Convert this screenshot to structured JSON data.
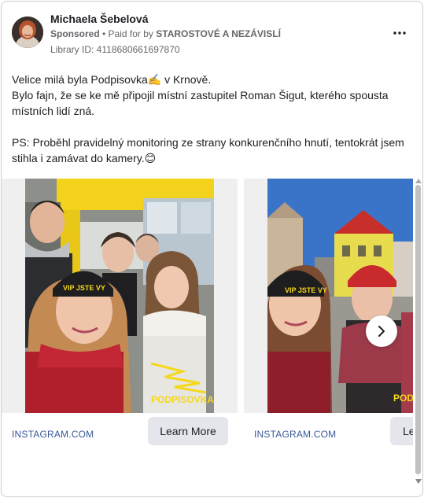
{
  "post": {
    "author": "Michaela Šebelová",
    "sponsored": "Sponsored",
    "paid_for_by_prefix": " • Paid for by ",
    "paid_for_by": "STAROSTOVÉ A NEZÁVISLÍ",
    "library_id": "Library ID: 4118680661697870",
    "body_line1": "Velice milá byla Podpisovka✍️  v Krnově.",
    "body_line2": "Bylo fajn, že se ke mě připojil místní zastupitel Roman Šigut, kterého spousta místních lidí zná.",
    "body_line3": "PS: Proběhl pravidelný monitoring ze strany konkurenčního hnutí, tentokrát jsem stihla i zamávat do kamery.😊"
  },
  "carousel": {
    "cards": [
      {
        "domain": "INSTAGRAM.COM",
        "cta": "Learn More",
        "hat_text": "VIP JSTE VY",
        "sticker_text": "PODPISOVKA"
      },
      {
        "domain": "INSTAGRAM.COM",
        "cta": "Le",
        "hat_text": "VIP JSTE VY",
        "sticker_text": "PODP"
      }
    ]
  },
  "icons": {
    "more": "more-options-icon",
    "next": "chevron-right-icon"
  },
  "colors": {
    "link": "#385898",
    "button_bg": "#e4e6eb",
    "meta_text": "#65676b"
  }
}
